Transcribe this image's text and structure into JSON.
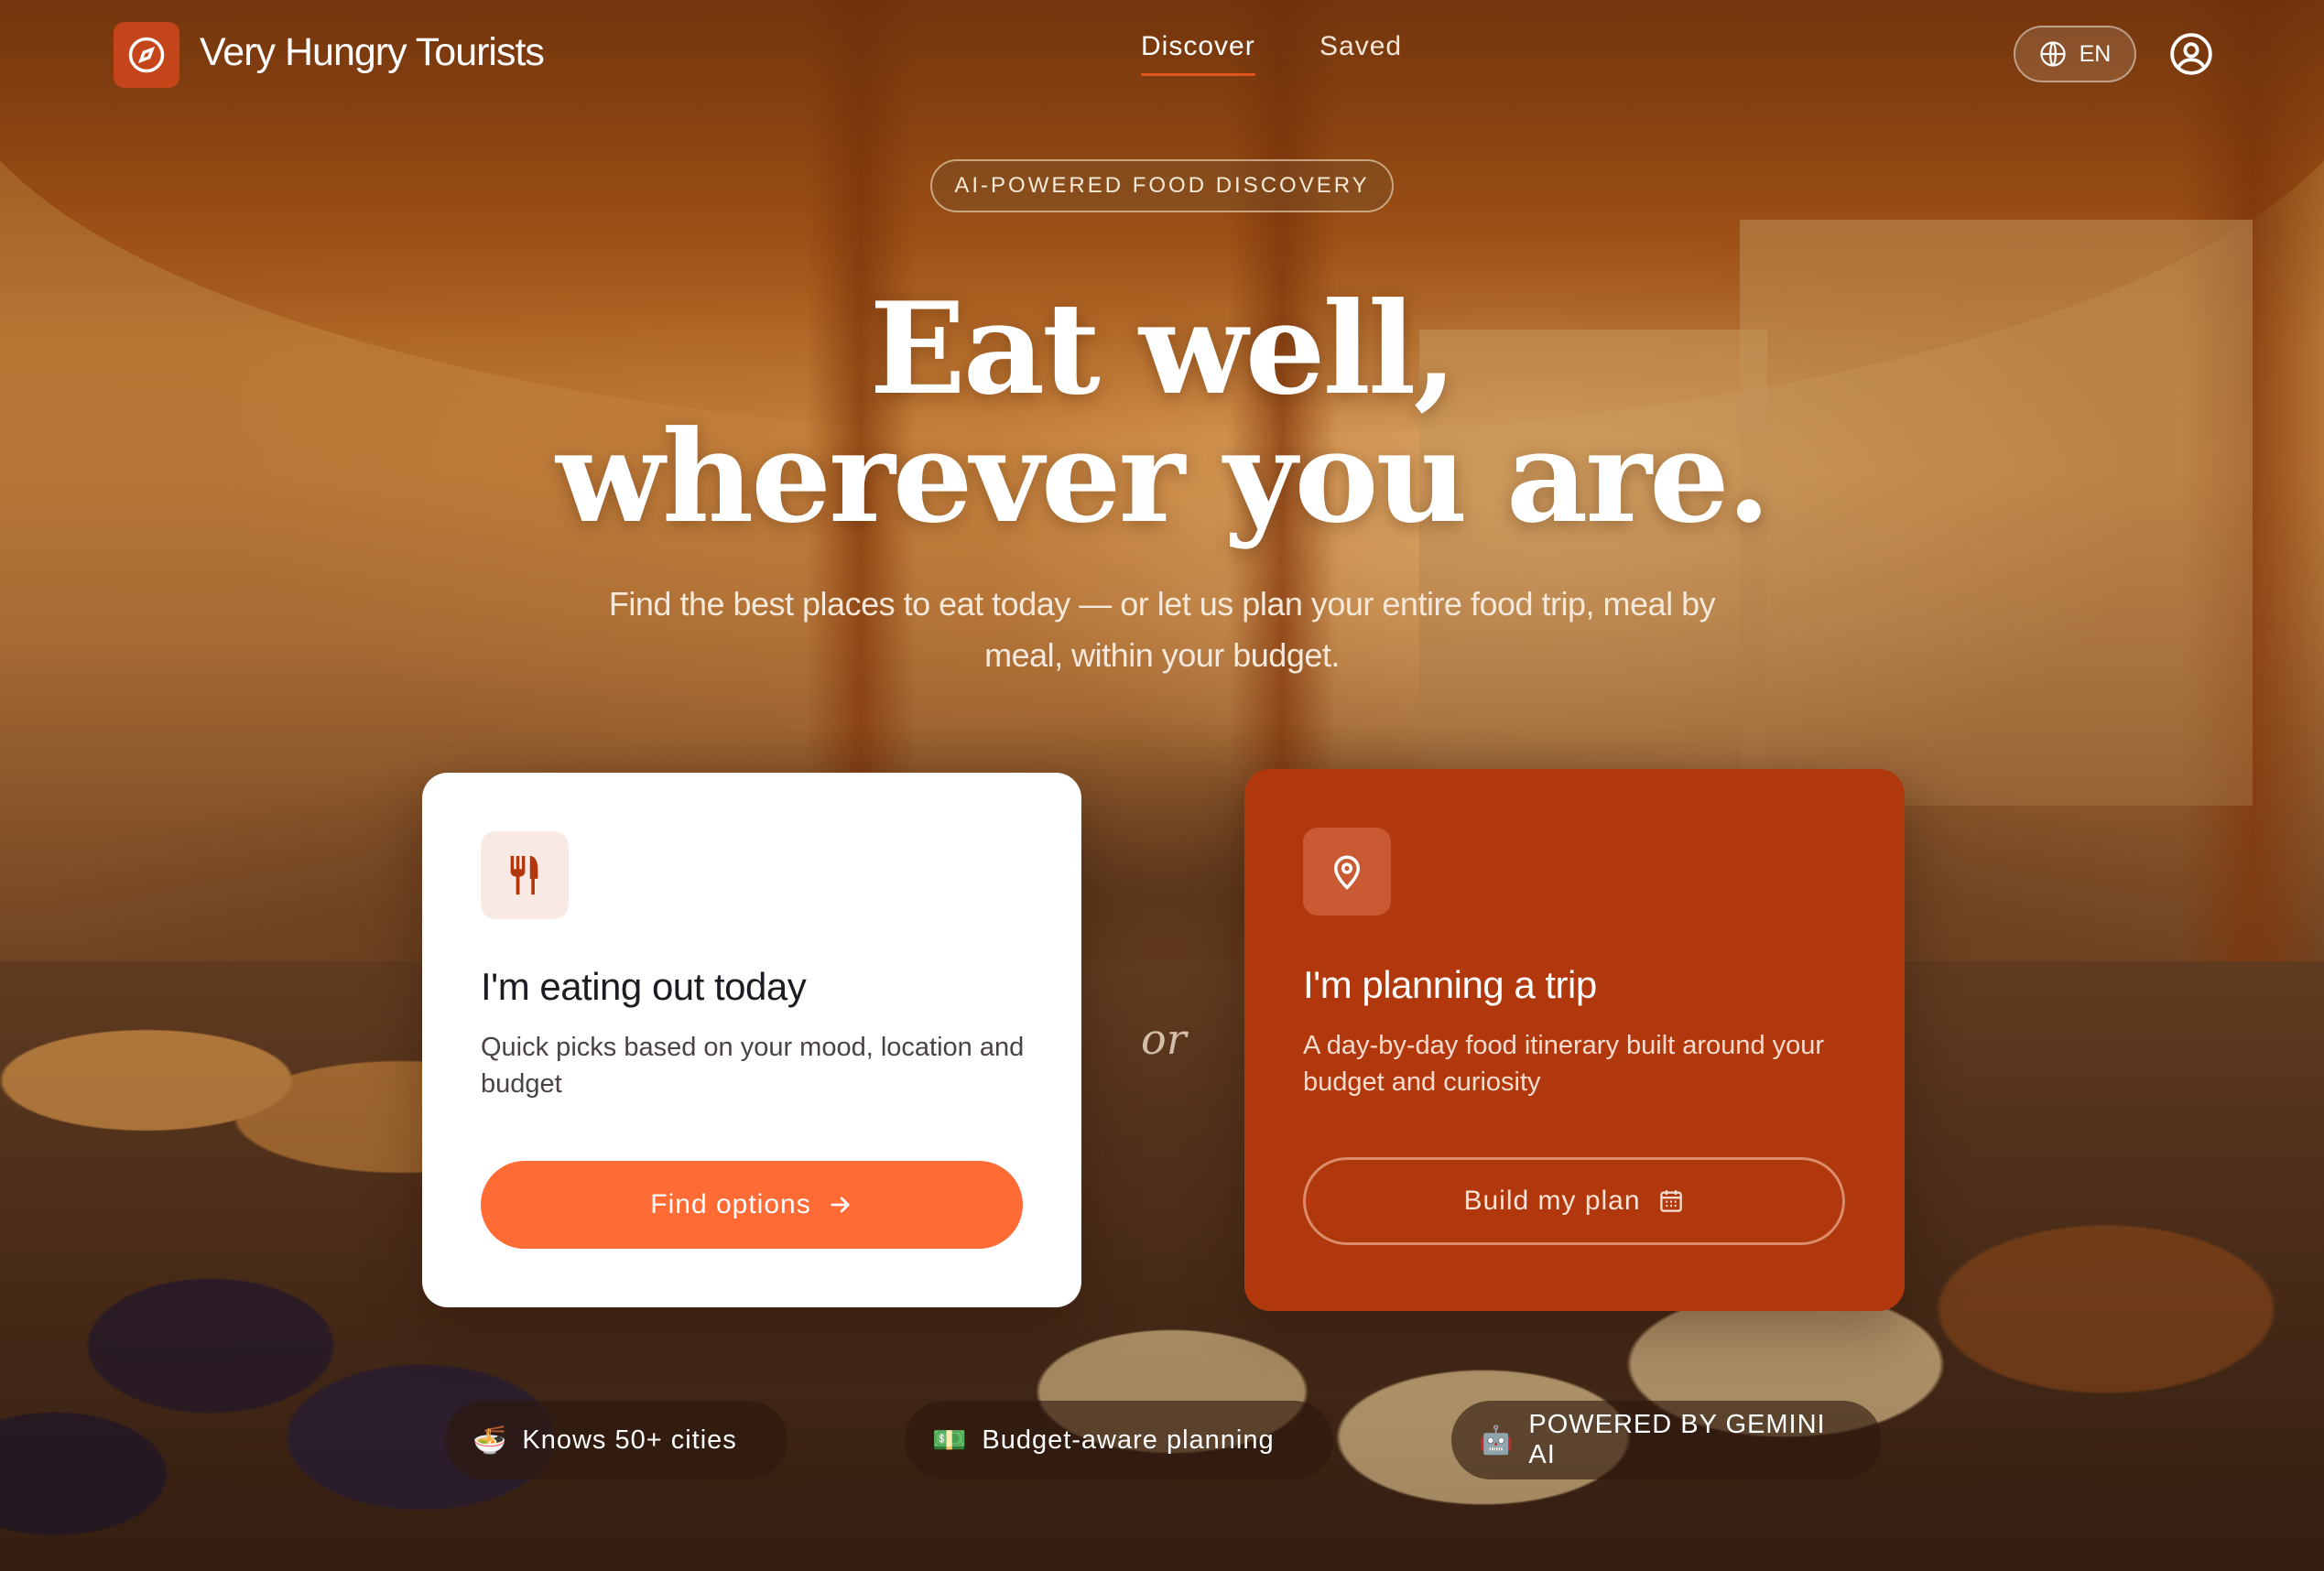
{
  "brand": {
    "name": "Very Hungry Tourists"
  },
  "nav": {
    "discover": "Discover",
    "saved": "Saved"
  },
  "lang": {
    "code": "EN"
  },
  "hero": {
    "badge": "AI-POWERED FOOD DISCOVERY",
    "title_line1": "Eat well,",
    "title_line2": "wherever you are.",
    "subtitle_line1": "Find the best places to eat today — or let us plan your entire food trip, meal by",
    "subtitle_line2": "meal, within your budget."
  },
  "cards": {
    "eat": {
      "title": "I'm eating out today",
      "description": "Quick picks based on your mood, location and budget",
      "button": "Find options"
    },
    "plan": {
      "title": "I'm planning a trip",
      "description": "A day-by-day food itinerary built around your budget and curiosity",
      "button": "Build my plan"
    },
    "separator": "or"
  },
  "features": [
    {
      "emoji": "🍜",
      "label": "Knows 50+ cities"
    },
    {
      "emoji": "💵",
      "label": "Budget-aware planning"
    },
    {
      "emoji": "🤖",
      "label": "POWERED BY GEMINI AI"
    }
  ],
  "colors": {
    "accent": "#ff6b35",
    "brand_dark": "#b1380c",
    "logo_bg": "#c4451a",
    "nav_underline": "#e2541f"
  },
  "icons": {
    "logo": "compass-icon",
    "lang": "globe-icon",
    "user": "user-circle-icon",
    "eat": "utensils-icon",
    "plan": "map-pin-icon",
    "find": "arrow-right-icon",
    "build": "calendar-icon"
  }
}
